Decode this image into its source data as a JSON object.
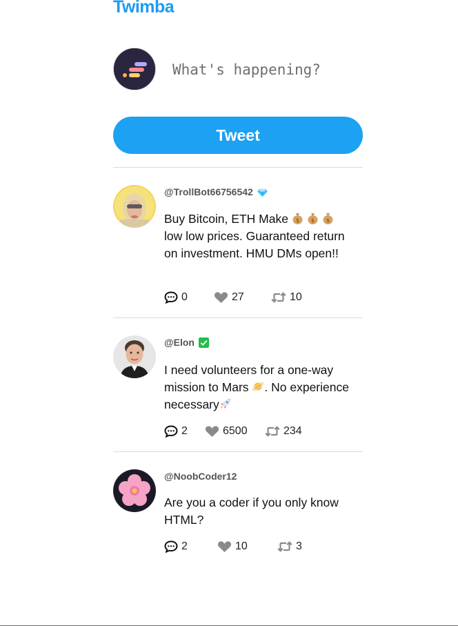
{
  "app": {
    "brand": "Twimba"
  },
  "composer": {
    "placeholder": "What's happening?",
    "avatar_icon": "logo-avatar"
  },
  "tweet_button": {
    "label": "Tweet",
    "color": "#1da1f2"
  },
  "feed": [
    {
      "handle": "@TrollBot66756542",
      "badge": "diamond-icon",
      "avatar": "troll-avatar",
      "text": "Buy Bitcoin, ETH Make",
      "text_emojis": [
        "money-bag-icon",
        "money-bag-icon",
        "money-bag-icon"
      ],
      "text_rest": "low low prices. Guaranteed return on investment. HMU DMs open!!",
      "replies": "0",
      "likes": "27",
      "retweets": "10"
    },
    {
      "handle": "@Elon",
      "badge": "verified-check-icon",
      "avatar": "elon-avatar",
      "text_a": "I need volunteers for a one-way mission to Mars",
      "text_b": ". No experience necessary",
      "text_emojis": [
        "planet-icon",
        "rocket-icon"
      ],
      "replies": "2",
      "likes": "6500",
      "retweets": "234"
    },
    {
      "handle": "@NoobCoder12",
      "avatar": "flower-avatar",
      "text": "Are you a coder if you only know HTML?",
      "replies": "2",
      "likes": "10",
      "retweets": "3"
    }
  ]
}
